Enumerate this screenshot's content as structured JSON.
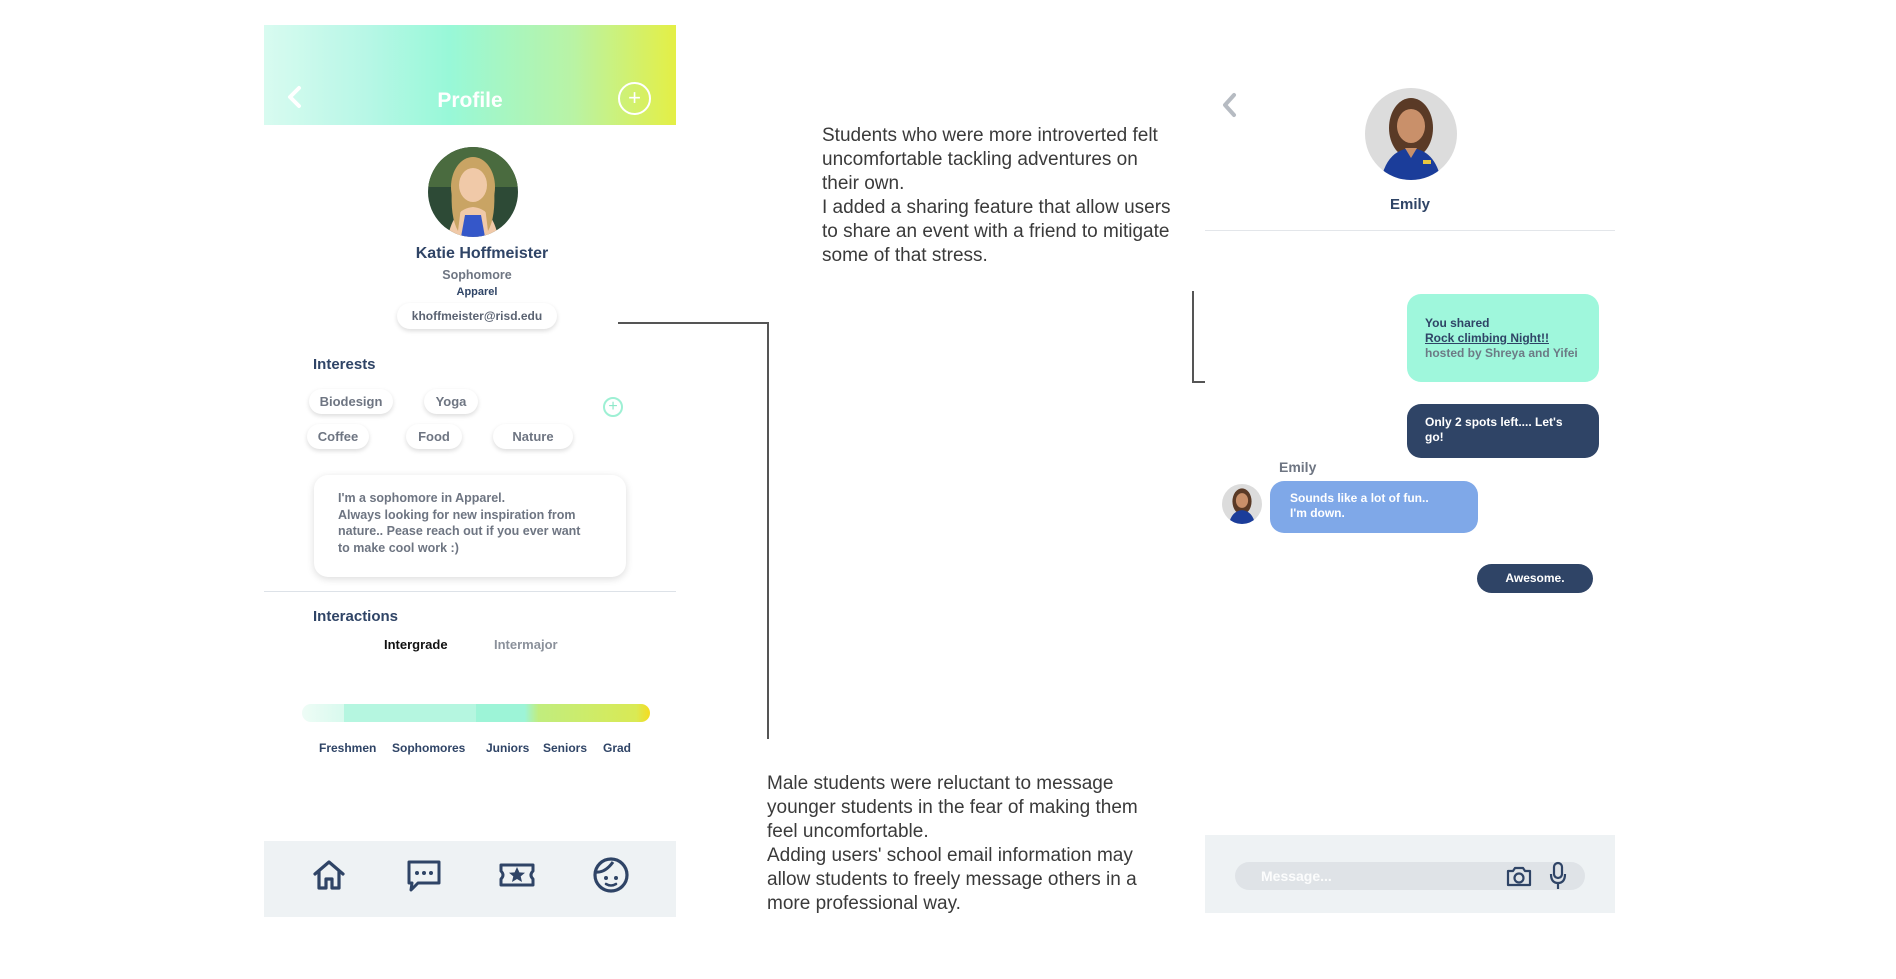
{
  "profile": {
    "header_title": "Profile",
    "plus_symbol": "+",
    "name": "Katie Hoffmeister",
    "year": "Sophomore",
    "major": "Apparel",
    "email": "khoffmeister@risd.edu",
    "interests_title": "Interests",
    "interests": [
      "Biodesign",
      "Yoga",
      "Coffee",
      "Food",
      "Nature"
    ],
    "add_interest_symbol": "+",
    "bio": "I'm a sophomore in Apparel.\nAlways looking for new inspiration from\nnature.. Pease reach out if you ever want\nto make cool work :)",
    "interactions_title": "Interactions",
    "tabs": [
      "Intergrade",
      "Intermajor"
    ],
    "active_tab": "Intergrade",
    "bar_labels": [
      "Freshmen",
      "Sophomores",
      "Juniors",
      "Seniors",
      "Grad"
    ],
    "nav_icons": [
      "home-icon",
      "chat-icon",
      "ticket-star-icon",
      "profile-face-icon"
    ],
    "header_gradient": [
      "#d8fbf0",
      "#98f8d8",
      "#e4ef45"
    ]
  },
  "notes": {
    "note_top": "Students who were more introverted felt\nuncomfortable tackling adventures on\ntheir own.\nI added a sharing feature that allow users\nto share an event with a friend to mitigate\nsome of that stress.",
    "note_bottom": "Male students were reluctant to message\nyounger students in the fear of making them\nfeel uncomfortable.\nAdding users' school email information may\nallow students to freely message others in a\nmore professional way."
  },
  "chat": {
    "contact_name": "Emily",
    "shared_prefix": "You shared",
    "shared_event": "Rock climbing Night!!",
    "shared_host": "hosted by Shreya and Yifei",
    "msg_spots": "Only 2 spots left.... Let's go!",
    "sender_label": "Emily",
    "msg_emily": "Sounds like a lot of fun..\nI'm down.",
    "msg_awesome": "Awesome.",
    "input_placeholder": "Message...",
    "colors": {
      "dark_bubble": "#2f4466",
      "mint_bubble": "#9ff7dc",
      "blue_bubble": "#7fa8e8"
    }
  }
}
